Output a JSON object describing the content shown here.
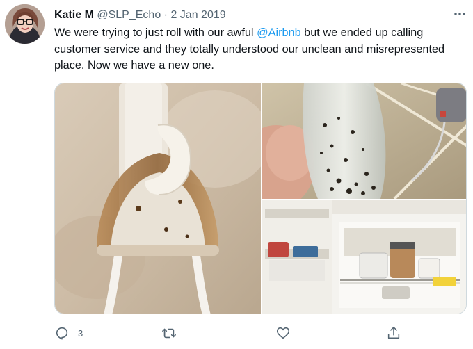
{
  "tweet": {
    "author_name": "Katie M",
    "author_handle": "@SLP_Echo",
    "separator": "·",
    "date": "2 Jan 2019",
    "text_part1": "We were trying to just roll with our awful ",
    "mention": "@Airbnb",
    "text_part2": " but we ended up calling customer service and they totally understood our unclean and misrepresented place. Now we have a new one.",
    "media": [
      {
        "subject": "stained-toothbrush-holder"
      },
      {
        "subject": "dirty-plastic-container"
      },
      {
        "subject": "refrigerator-interior"
      }
    ]
  },
  "actions": {
    "reply_count": "3",
    "retweet_count": "",
    "like_count": ""
  },
  "icons": {
    "more": "more-horizontal-icon",
    "reply": "reply-icon",
    "retweet": "retweet-icon",
    "like": "heart-icon",
    "share": "share-icon"
  },
  "colors": {
    "text": "#0f1419",
    "secondary": "#536471",
    "link": "#1d9bf0",
    "border": "#cfd9de"
  }
}
